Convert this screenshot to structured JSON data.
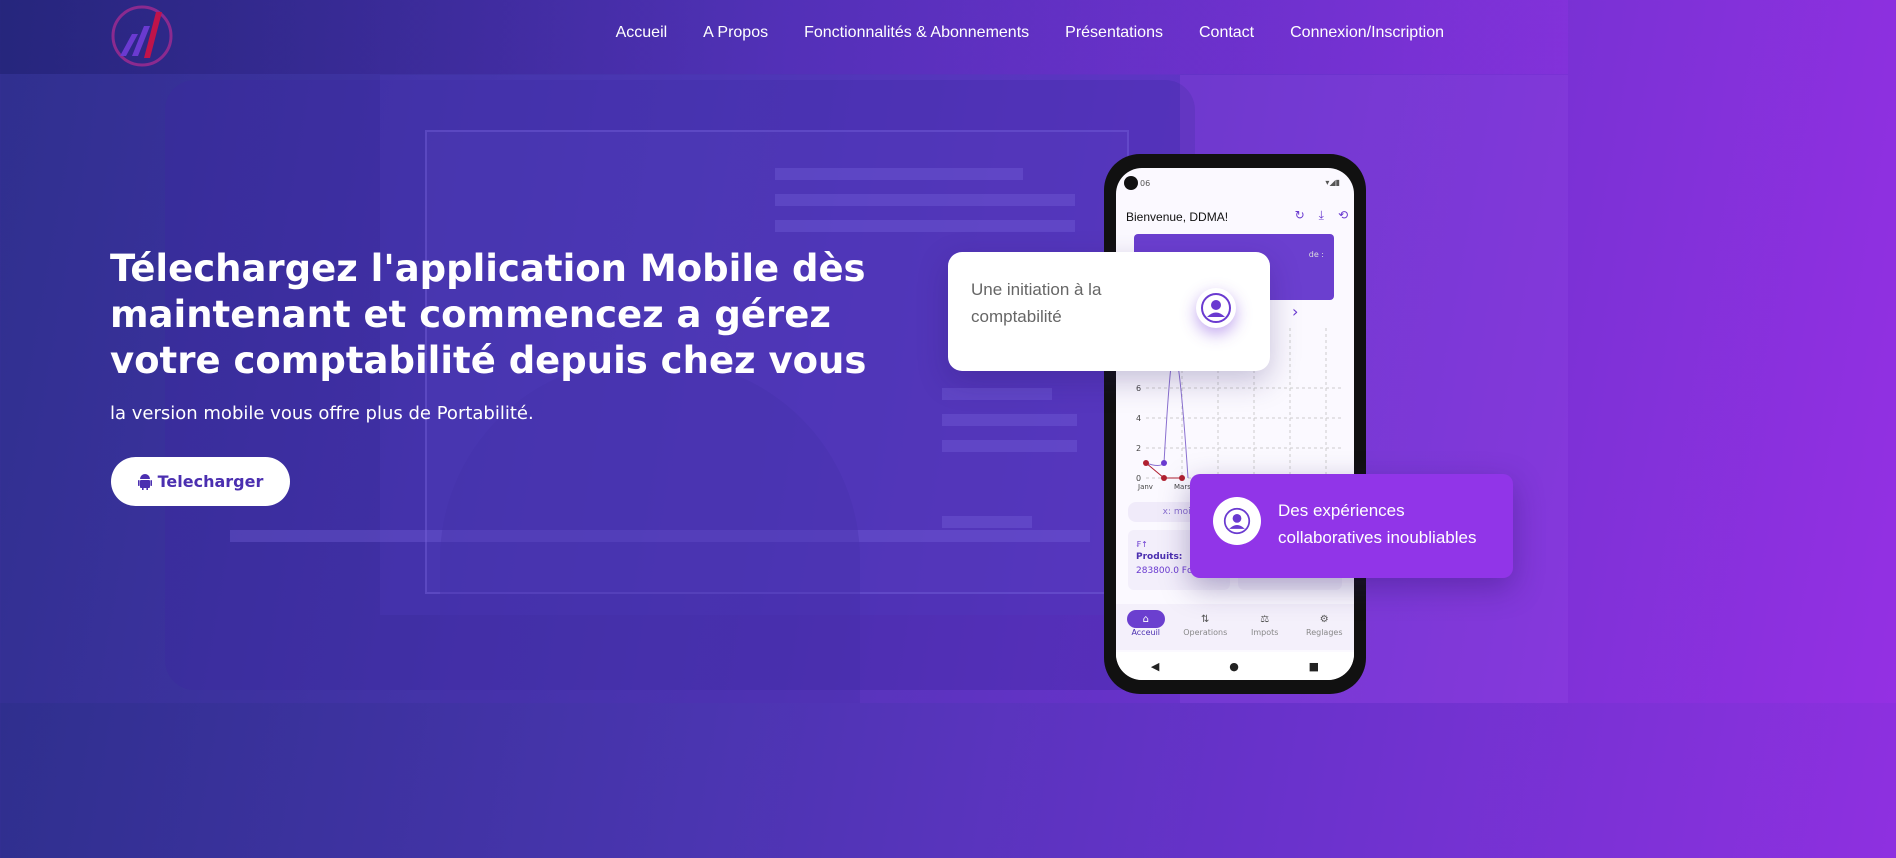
{
  "nav": {
    "links": [
      "Accueil",
      "A Propos",
      "Fonctionnalités & Abonnements",
      "Présentations",
      "Contact",
      "Connexion/Inscription"
    ]
  },
  "hero": {
    "title": "Télechargez l'application Mobile dès maintenant et commencez a gérez votre comptabilité depuis chez vous",
    "subtitle": "la version mobile vous offre plus de Portabilité.",
    "download_label": "Telecharger"
  },
  "phone": {
    "status_time": "06",
    "welcome": "Bienvenue, DDMA!",
    "card_text": "de :",
    "chart_y_ticks": [
      "6",
      "4",
      "2",
      "0"
    ],
    "chart_x_ticks": [
      "Janv",
      "Mars"
    ],
    "filter_label": "x: mois",
    "income_label": "Produits:",
    "income_value": "283800.0 Fcfa",
    "bottom_nav": [
      "Acceuil",
      "Operations",
      "Impots",
      "Reglages"
    ]
  },
  "cards": {
    "initiation": "Une initiation à la comptabilité",
    "collab": "Des expériences collaboratives inoubliables"
  },
  "colors": {
    "accent": "#6b3fcf",
    "collab_card": "#9135e8",
    "button_text": "#4b2fb0"
  }
}
